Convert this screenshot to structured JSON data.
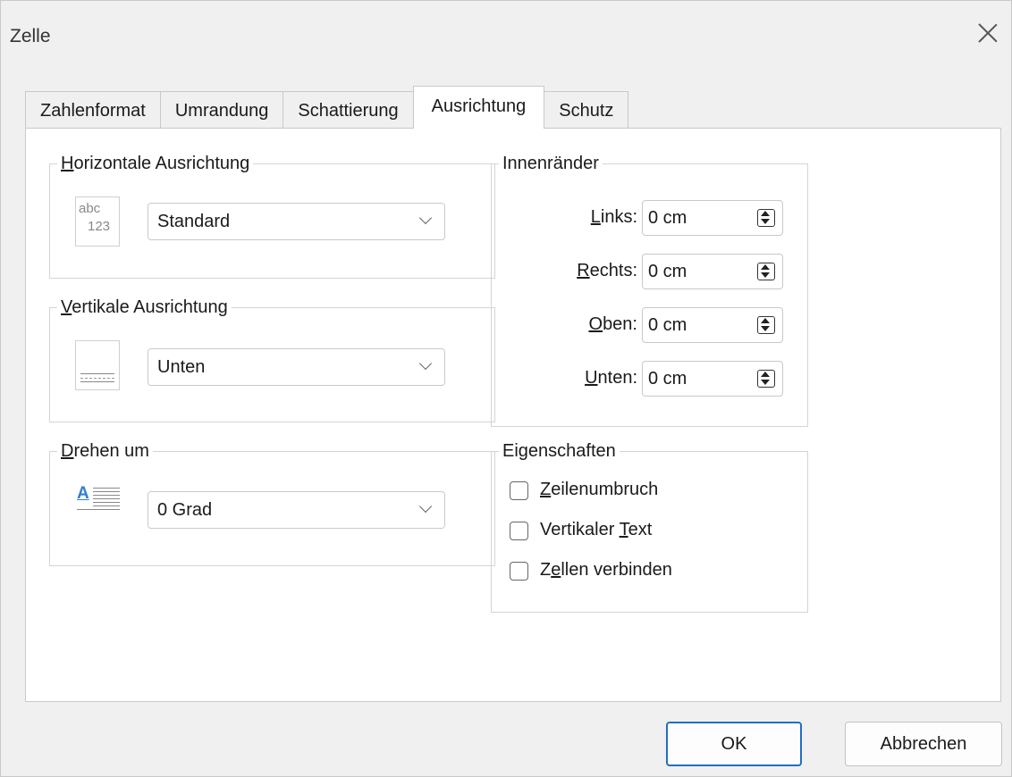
{
  "window": {
    "title": "Zelle"
  },
  "tabs": [
    {
      "label": "Zahlenformat"
    },
    {
      "label": "Umrandung"
    },
    {
      "label": "Schattierung"
    },
    {
      "label": "Ausrichtung",
      "active": true
    },
    {
      "label": "Schutz"
    }
  ],
  "horizontal": {
    "legend_u": "H",
    "legend_rest": "orizontale Ausrichtung",
    "icon_top": "abc",
    "icon_bottom": "123",
    "selected": "Standard"
  },
  "vertical": {
    "legend_u": "V",
    "legend_rest": "ertikale Ausrichtung",
    "selected": "Unten"
  },
  "rotate": {
    "legend_u": "D",
    "legend_rest": "rehen um",
    "icon_letter": "A",
    "selected": "0 Grad"
  },
  "margins": {
    "legend": "Innenränder",
    "rows": [
      {
        "label_u": "L",
        "label_rest": "inks:",
        "value": "0 cm"
      },
      {
        "label_u": "R",
        "label_rest": "echts:",
        "value": "0 cm"
      },
      {
        "label_u": "O",
        "label_rest": "ben:",
        "value": "0 cm"
      },
      {
        "label_u": "U",
        "label_rest": "nten:",
        "value": "0 cm"
      }
    ]
  },
  "properties": {
    "legend": "Eigenschaften",
    "items": [
      {
        "pre": "",
        "u": "Z",
        "post": "eilenumbruch",
        "checked": false
      },
      {
        "pre": "Vertikaler ",
        "u": "T",
        "post": "ext",
        "checked": false
      },
      {
        "pre": "Z",
        "u": "e",
        "post": "llen verbinden",
        "checked": false
      }
    ]
  },
  "buttons": {
    "ok": "OK",
    "cancel": "Abbrechen"
  },
  "colors": {
    "accent": "#1f6fc5",
    "icon_blue": "#2f7fd1"
  }
}
